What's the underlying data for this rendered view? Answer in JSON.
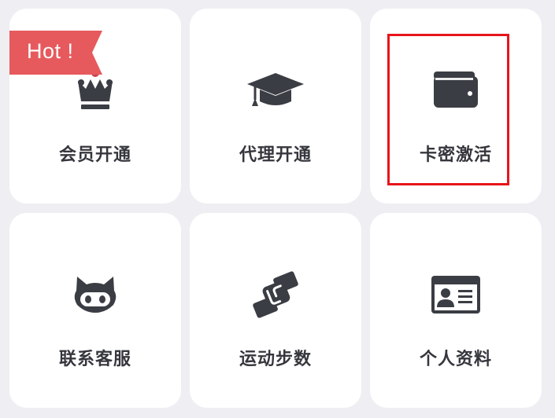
{
  "badge": {
    "hot_label": "Hot !"
  },
  "colors": {
    "icon": "#3b3d44",
    "label": "#35373d",
    "ribbon": "#e65a5d",
    "highlight": "#e8141b",
    "card": "#ffffff",
    "background": "#efeef3"
  },
  "menu": {
    "items": [
      {
        "label": "会员开通",
        "icon": "crown-icon"
      },
      {
        "label": "代理开通",
        "icon": "graduation-cap-icon"
      },
      {
        "label": "卡密激活",
        "icon": "wallet-icon",
        "highlighted": true
      },
      {
        "label": "联系客服",
        "icon": "cat-face-icon"
      },
      {
        "label": "运动步数",
        "icon": "handshake-icon"
      },
      {
        "label": "个人资料",
        "icon": "id-card-icon"
      }
    ]
  }
}
